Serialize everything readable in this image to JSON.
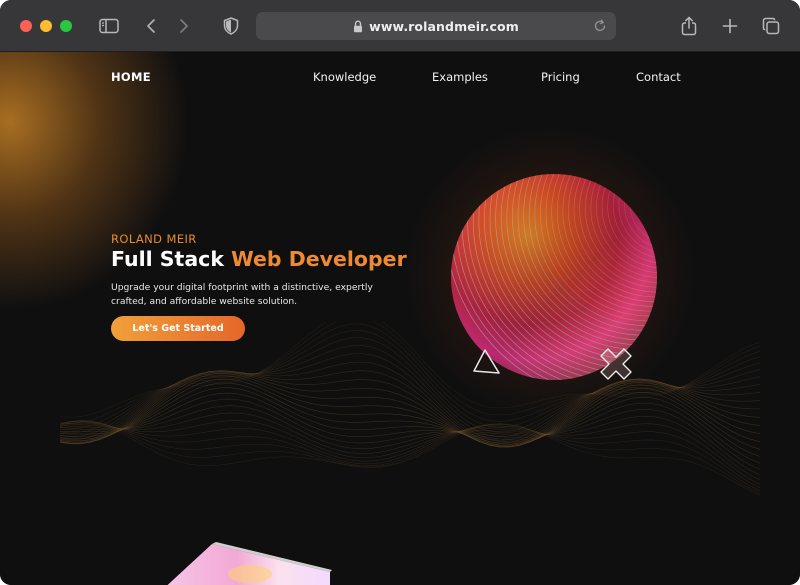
{
  "browser": {
    "url": "www.rolandmeir.com",
    "icons": {
      "sidebar": "sidebar-toggle-icon",
      "back": "chevron-left-icon",
      "forward": "chevron-right-icon",
      "shield": "shield-icon",
      "lock": "lock-icon",
      "reload": "reload-icon",
      "share": "share-icon",
      "new_tab": "plus-icon",
      "tabs": "tab-overview-icon"
    }
  },
  "nav": {
    "home": "HOME",
    "links": [
      "Knowledge",
      "Examples",
      "Pricing",
      "Contact"
    ]
  },
  "hero": {
    "eyebrow": "ROLAND MEIR",
    "title_plain": "Full Stack ",
    "title_accent": "Web Developer",
    "subtitle": "Upgrade your digital footprint with a distinctive, expertly crafted, and affordable website solution.",
    "cta": "Let's Get Started"
  },
  "colors": {
    "accent": "#ee8a34",
    "cta_start": "#f0a03a",
    "cta_end": "#e6662a",
    "background": "#0f0f10",
    "chrome": "#37373a"
  }
}
